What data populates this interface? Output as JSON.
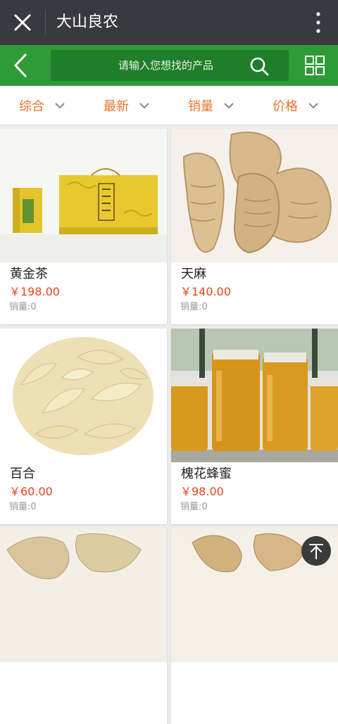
{
  "header": {
    "title": "大山良农",
    "icons": [
      "close-icon",
      "more-vert-icon"
    ]
  },
  "search": {
    "placeholder": "请输入您想找的产品",
    "icons": [
      "back-icon",
      "search-icon",
      "grid-view-icon"
    ]
  },
  "filters": [
    {
      "label": "综合"
    },
    {
      "label": "最新"
    },
    {
      "label": "销量"
    },
    {
      "label": "价格"
    }
  ],
  "products": [
    {
      "name": "黄金茶",
      "price": "￥198.00",
      "sales": "销量:0",
      "image": "yellow-tea-box"
    },
    {
      "name": "天麻",
      "price": "￥140.00",
      "sales": "销量:0",
      "image": "gastrodia-root"
    },
    {
      "name": "百合",
      "price": "￥60.00",
      "sales": "销量:0",
      "image": "dried-lily-slices"
    },
    {
      "name": "槐花蜂蜜",
      "price": "￥98.00",
      "sales": "销量:0",
      "image": "honey-jars"
    },
    {
      "name": "",
      "price": "",
      "sales": "",
      "image": "dried-root-slices"
    },
    {
      "name": "",
      "price": "",
      "sales": "",
      "image": "ginger-roots"
    }
  ],
  "colors": {
    "topbar": "#393a3f",
    "green": "#2e9c36",
    "accent": "#e8762f",
    "price": "#e8441b"
  }
}
